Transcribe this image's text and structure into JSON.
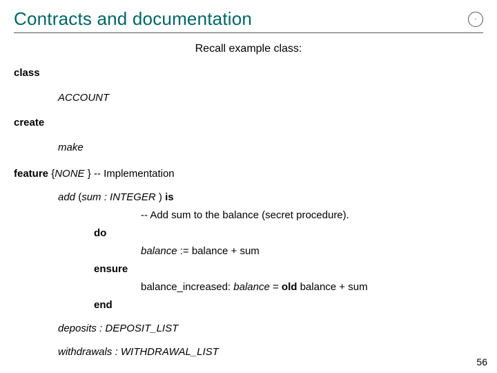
{
  "header": {
    "title": "Contracts and documentation",
    "logo_glyph": "◦"
  },
  "subtitle": "Recall example class:",
  "code": {
    "kw_class": "class",
    "class_name": "ACCOUNT",
    "kw_create": "create",
    "creator": "make",
    "feature_kw": "feature",
    "feature_vis_open": "{",
    "feature_vis": "NONE ",
    "feature_vis_close": "} ",
    "feature_comment": "-- Implementation",
    "add_name": "add  ",
    "add_sig_open": "(",
    "add_arg": "sum ",
    "add_colon_type": " : INTEGER ",
    "add_sig_close": ") ",
    "kw_is": "is",
    "add_comment": "-- Add sum to the balance (secret procedure).",
    "kw_do": "do",
    "assign_lhs": "balance ",
    "assign_rest": " := balance + sum",
    "kw_ensure": "ensure",
    "post_tag": "balance_increased: ",
    "post_lhs": "balance ",
    "post_eq": " = ",
    "kw_old": "old",
    "post_rhs": " balance + sum",
    "kw_end": "end",
    "deposits_name": "deposits ",
    "deposits_type": " : DEPOSIT_LIST",
    "withdrawals_name": "withdrawals ",
    "withdrawals_type": " : WITHDRAWAL_LIST"
  },
  "page_number": "56"
}
